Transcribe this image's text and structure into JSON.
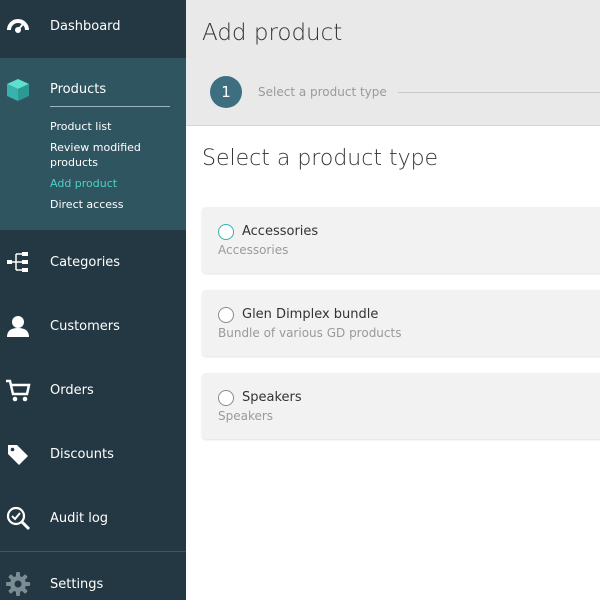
{
  "sidebar": {
    "items": [
      {
        "label": "Dashboard",
        "icon": "speedometer-icon"
      },
      {
        "label": "Products",
        "icon": "box-icon"
      },
      {
        "label": "Categories",
        "icon": "hierarchy-icon"
      },
      {
        "label": "Customers",
        "icon": "user-icon"
      },
      {
        "label": "Orders",
        "icon": "cart-icon"
      },
      {
        "label": "Discounts",
        "icon": "tags-icon"
      },
      {
        "label": "Audit log",
        "icon": "magnifier-check-icon"
      },
      {
        "label": "Settings",
        "icon": "gear-icon"
      }
    ],
    "products_sub": [
      {
        "label": "Product list"
      },
      {
        "label": "Review modified products"
      },
      {
        "label": "Add product"
      },
      {
        "label": "Direct access"
      }
    ],
    "active_sub_color": "#4fd1c5"
  },
  "header": {
    "title": "Add product",
    "step_number": "1",
    "step_label": "Select a product type"
  },
  "main": {
    "section_title": "Select a product type",
    "options": [
      {
        "name": "Accessories",
        "description": "Accessories"
      },
      {
        "name": "Glen Dimplex bundle",
        "description": "Bundle of various GD products"
      },
      {
        "name": "Speakers",
        "description": "Speakers"
      }
    ]
  },
  "colors": {
    "sidebar_bg": "#233842",
    "active_bg": "#2f5561",
    "step_circle": "#3e6f80"
  }
}
